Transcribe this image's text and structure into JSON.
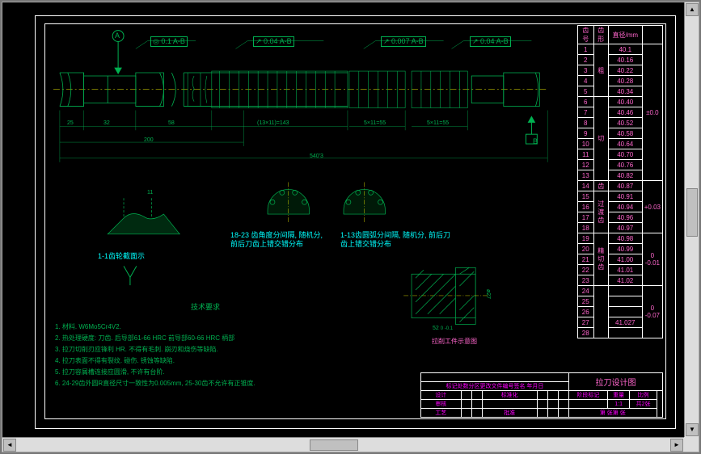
{
  "tolerances": {
    "t1": "0.1 A-B",
    "t2": "0.04 A-B",
    "t3": "0.007 A-B",
    "t4": "0.04 A-B"
  },
  "dimensions": {
    "d25": "25",
    "d32": "32",
    "d58": "58",
    "d200": "200",
    "span1": "(13×11)=143",
    "span2": "5×11=55",
    "span3": "5×11=55",
    "s4023": "540'3",
    "small11": "11",
    "d52": "52",
    "tol52": "0  -0.1",
    "phi27": "ø27",
    "vmark": "▽"
  },
  "labels": {
    "note_left": "1-1齿轮截面示",
    "note_mid": "18-23 齿角度分间隔, 随机分,\n前后刀齿上错交错分布",
    "note_right": "1-13齿圆弧分间隔, 随机分, 前后刀\n齿上错交错分布",
    "section_bottom": "拉削工件示意图"
  },
  "tech_title": "技术要求",
  "tech_req": [
    "1. 材料. W6Mo5Cr4V2.",
    "2. 热处理硬度: 刀齿. 后导部61-66 HRC 前导部60-66 HRC 柄部",
    "3. 拉刀切削刃应锋利 HR. 不得有毛刺. 崩刃和烧伤等缺陷.",
    "4. 拉刀表面不得有裂纹. 碰伤. 锈蚀等缺陷.",
    "5. 拉刀容屑槽连接应圆滑, 不许有台阶.",
    "6. 24-29齿外圆R直径尺寸一致性为0.005mm, 25-30齿不允许有正锥度."
  ],
  "table_headers": {
    "col1": "齿号",
    "col2": "齿形",
    "col3": "直径/mm",
    "col4": ""
  },
  "teeth_groups": [
    {
      "label": "粗",
      "span": 5
    },
    {
      "label": "切",
      "span": 8
    },
    {
      "label": "齿",
      "span": 1
    },
    {
      "label": "过 渡 齿",
      "span": 4
    },
    {
      "label": "精 切 齿",
      "span": 5
    }
  ],
  "teeth": [
    {
      "n": "1",
      "d": "40.1"
    },
    {
      "n": "2",
      "d": "40.16"
    },
    {
      "n": "3",
      "d": "40.22"
    },
    {
      "n": "4",
      "d": "40.28"
    },
    {
      "n": "5",
      "d": "40.34"
    },
    {
      "n": "6",
      "d": "40.40"
    },
    {
      "n": "7",
      "d": "40.46"
    },
    {
      "n": "8",
      "d": "40.52"
    },
    {
      "n": "9",
      "d": "40.58"
    },
    {
      "n": "10",
      "d": "40.64"
    },
    {
      "n": "11",
      "d": "40.70"
    },
    {
      "n": "12",
      "d": "40.76"
    },
    {
      "n": "13",
      "d": "40.82"
    },
    {
      "n": "14",
      "d": "40.87"
    },
    {
      "n": "15",
      "d": "40.91"
    },
    {
      "n": "16",
      "d": "40.94"
    },
    {
      "n": "17",
      "d": "40.96"
    },
    {
      "n": "18",
      "d": "40.97"
    },
    {
      "n": "19",
      "d": "40.98"
    },
    {
      "n": "20",
      "d": "40.99"
    },
    {
      "n": "21",
      "d": "41.00"
    },
    {
      "n": "22",
      "d": "41.01"
    },
    {
      "n": "23",
      "d": "41.02"
    },
    {
      "n": "24",
      "d": ""
    },
    {
      "n": "25",
      "d": ""
    },
    {
      "n": "26",
      "d": ""
    },
    {
      "n": "27",
      "d": "41.027"
    },
    {
      "n": "28",
      "d": ""
    }
  ],
  "tol_col": {
    "a": "±0.0",
    "b": "+0.03",
    "c": "0  -0.01",
    "d": "0  -0.07"
  },
  "titleblock": {
    "title": "拉刀设计图",
    "row1": "标记处数分区更改文件编号签名 年月日",
    "design": "设计",
    "stdchk": "标准化",
    "stage": "阶段标记",
    "weight": "重量",
    "scale": "比例",
    "scale_val": "1:1",
    "sheets": "共2张",
    "check": "审核",
    "tech": "工艺",
    "approve": "批准",
    "sheet": "第 张第 张"
  },
  "datum": {
    "A": "A",
    "B": "B"
  }
}
